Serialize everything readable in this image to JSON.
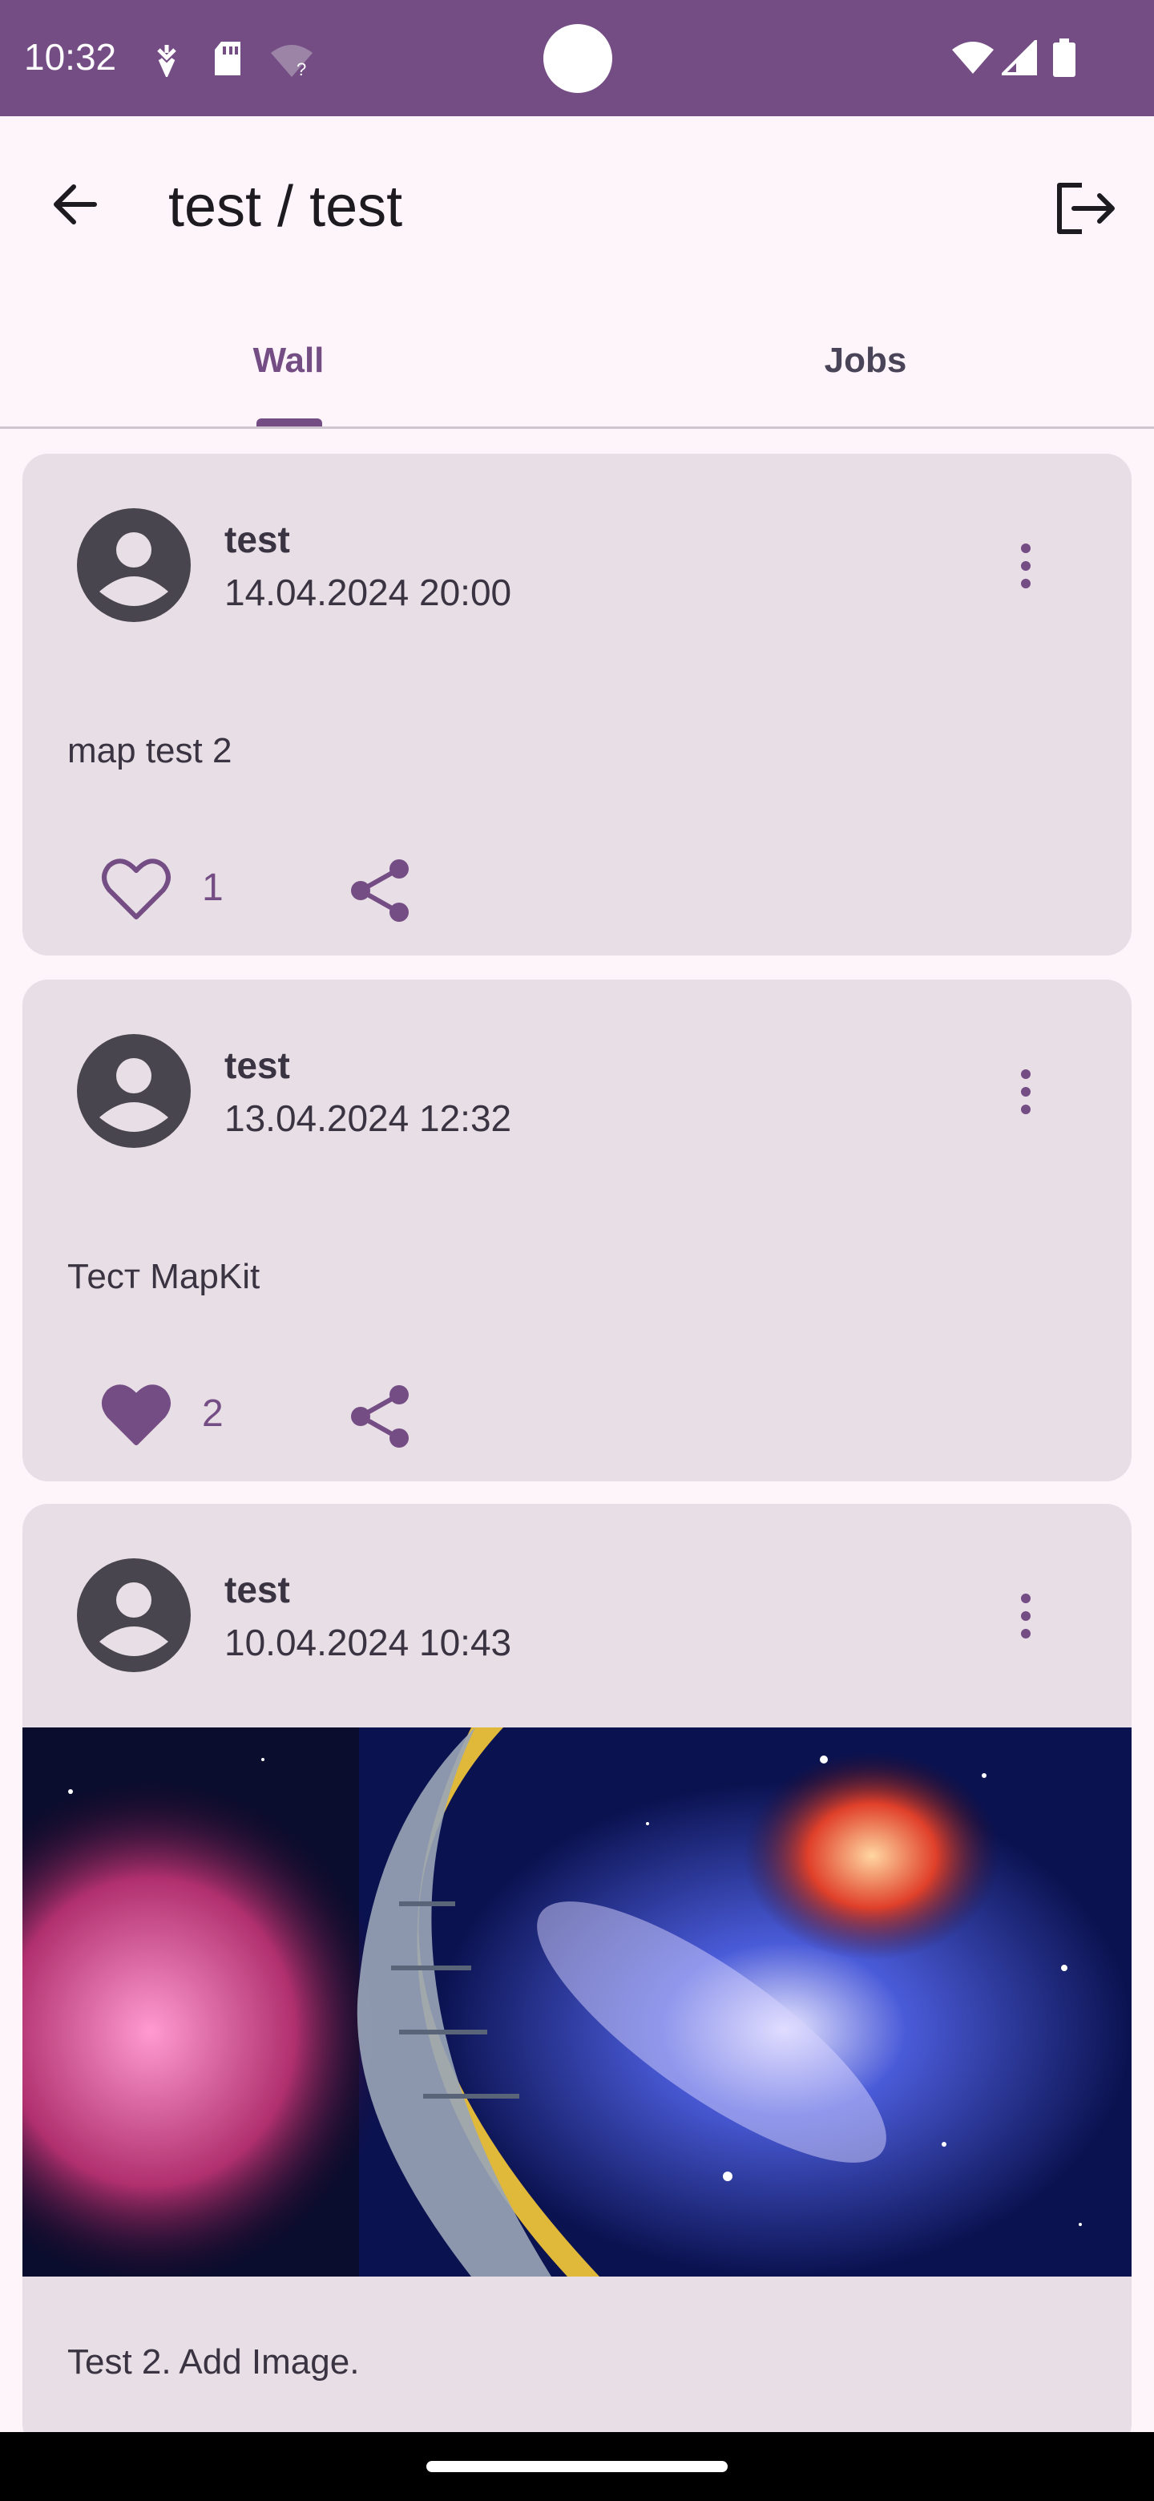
{
  "status_bar": {
    "time": "10:32",
    "icons": [
      "notification-icon",
      "sd-card-icon",
      "wifi-unknown-icon",
      "wifi-icon",
      "cell-signal-icon",
      "battery-icon"
    ],
    "background": "#754d85"
  },
  "app_bar": {
    "title": "test / test",
    "back_icon": "arrow-back-icon",
    "logout_icon": "logout-icon"
  },
  "tabs": [
    {
      "label": "Wall",
      "selected": true
    },
    {
      "label": "Jobs",
      "selected": false
    }
  ],
  "colors": {
    "accent": "#754d85",
    "card_background": "#e8dfe6",
    "page_background": "#fdf5fa"
  },
  "posts": [
    {
      "author": "test",
      "date": "14.04.2024 20:00",
      "content": "map test 2",
      "likes": "1",
      "liked": false
    },
    {
      "author": "test",
      "date": "13.04.2024 12:32",
      "content": "Тест MapKit",
      "likes": "2",
      "liked": true
    },
    {
      "author": "test",
      "date": "10.04.2024 10:43",
      "image": "galaxy-crescent-moon-city-painting",
      "content": "Test 2. Add Image."
    }
  ]
}
